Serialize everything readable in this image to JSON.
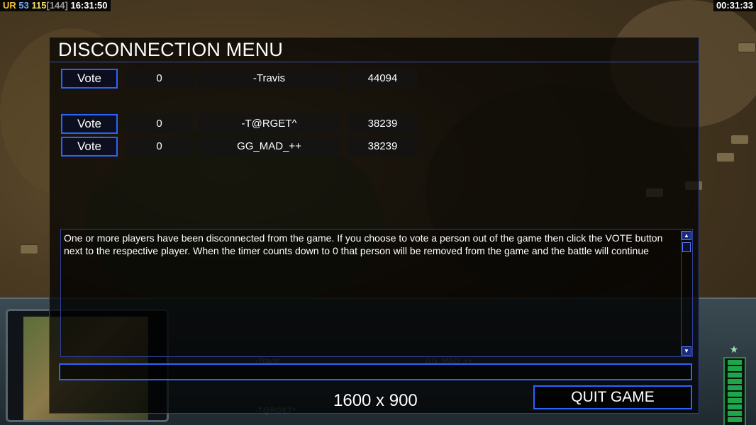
{
  "hud": {
    "label_ur": "UR",
    "value_53": "53",
    "value_115": "115",
    "value_144": "[144]",
    "clock": "16:31:50",
    "elapsed": "00:31:33"
  },
  "dialog": {
    "title": "DISCONNECTION MENU",
    "rows": [
      {
        "vote_label": "Vote",
        "count": "0",
        "player": "-Travis",
        "ping": "44094"
      },
      {
        "vote_label": "Vote",
        "count": "0",
        "player": "-T@RGET^",
        "ping": "38239"
      },
      {
        "vote_label": "Vote",
        "count": "0",
        "player": "GG_MAD_++",
        "ping": "38239"
      }
    ],
    "message": "One or more players have been disconnected from the game. If you choose to vote a person out of the game then click the VOTE button next to the respective player. When the timer counts down to 0 that person will be removed from the game and the battle will continue",
    "chat_value": "",
    "quit_label": "QUIT GAME"
  },
  "overlay": {
    "resolution": "1600 x 900"
  },
  "colors": {
    "accent": "#2b63ff",
    "border": "#2e3f9a",
    "power": "#1fa64a"
  }
}
